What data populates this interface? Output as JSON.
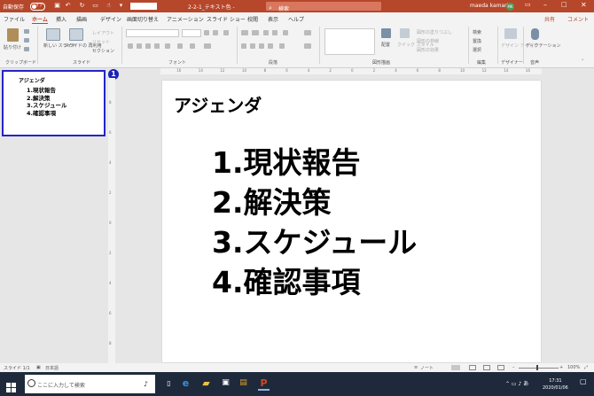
{
  "titlebar": {
    "autosave_label": "自動保存",
    "autosave_state": "オフ",
    "document_title": "2-2-1_テキスト色 -",
    "search_placeholder": "検索",
    "user_name": "maeda kamari",
    "user_initials": "MK"
  },
  "tabs": [
    {
      "label": "ファイル",
      "active": false
    },
    {
      "label": "ホーム",
      "active": true
    },
    {
      "label": "挿入",
      "active": false
    },
    {
      "label": "描画",
      "active": false
    },
    {
      "label": "デザイン",
      "active": false
    },
    {
      "label": "画面切り替え",
      "active": false
    },
    {
      "label": "アニメーション",
      "active": false
    },
    {
      "label": "スライド ショー",
      "active": false
    },
    {
      "label": "校閲",
      "active": false
    },
    {
      "label": "表示",
      "active": false
    },
    {
      "label": "ヘルプ",
      "active": false
    }
  ],
  "share_label": "共有",
  "comment_label": "コメント",
  "ribbon": {
    "paste_label": "貼り付け",
    "new_slide_label": "新しい スライド",
    "reuse_slide_label": "スライドの 再利用",
    "layout_label": "レイアウト",
    "reset_label": "リセット",
    "section_label": "セクション",
    "arrange_label": "配置",
    "quick_style_label": "クイック スタイル",
    "shape_fill_label": "図形の塗りつぶし",
    "shape_outline_label": "図形の枠線",
    "shape_effects_label": "図形の効果",
    "find_label": "検索",
    "replace_label": "置換",
    "select_label": "選択",
    "designer_label": "デザイン アイデア",
    "dictate_label": "ディクテーション",
    "groups": {
      "clipboard": "クリップボード",
      "slides": "スライド",
      "font": "フォント",
      "paragraph": "段落",
      "drawing": "図形描画",
      "editing": "編集",
      "designer": "デザイナー",
      "voice": "音声"
    }
  },
  "thumbnail": {
    "slide_number": "1",
    "marker": "1"
  },
  "slide": {
    "title": "アジェンダ",
    "items": [
      "1.現状報告",
      "2.解決策",
      "3.スケジュール",
      "4.確認事項"
    ]
  },
  "statusbar": {
    "slide_info": "スライド 1/1",
    "language": "日本語",
    "notes_label": "ノート",
    "zoom": "100%"
  },
  "taskbar": {
    "search_placeholder": "ここに入力して検索",
    "time": "17:31",
    "date": "2020/01/06"
  },
  "colors": {
    "accent": "#b7472a",
    "selection": "#2424c6",
    "taskbar": "#1e2a3c"
  }
}
